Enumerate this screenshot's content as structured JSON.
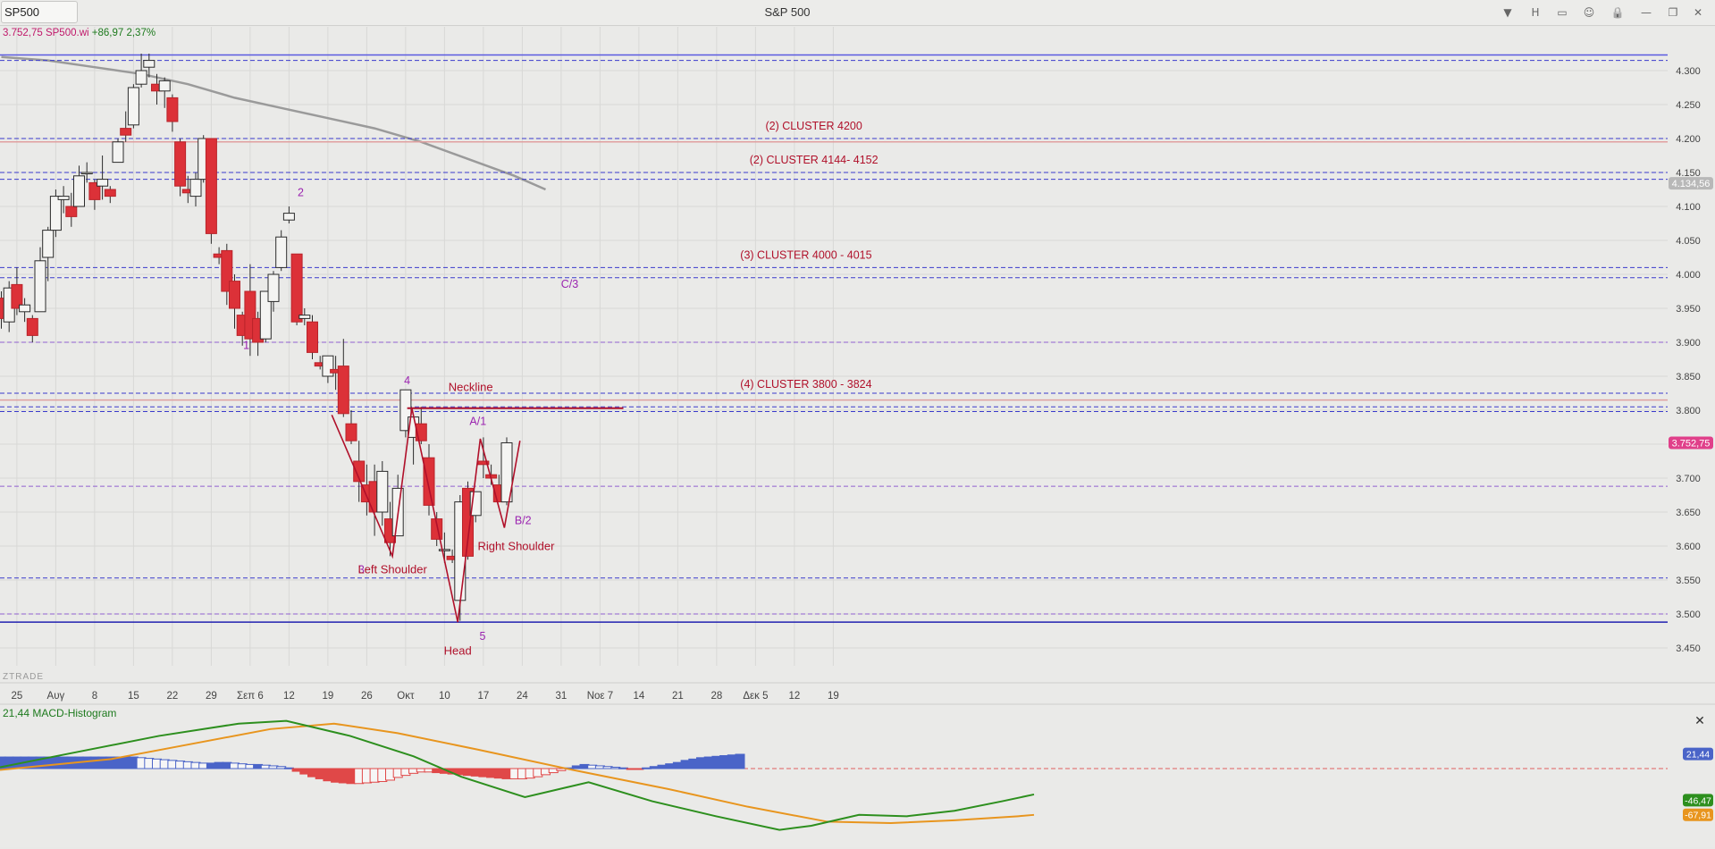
{
  "window": {
    "symbol": "SP500",
    "title": "S&P 500",
    "toolbar": [
      {
        "name": "dropdown-icon",
        "glyph": "▼"
      },
      {
        "name": "interval-button",
        "glyph": "H"
      },
      {
        "name": "layout-icon",
        "glyph": "▭"
      },
      {
        "name": "chat-icon",
        "glyph": "☺"
      },
      {
        "name": "lock-icon",
        "glyph": "🔒"
      },
      {
        "name": "minimize-icon",
        "glyph": "—"
      },
      {
        "name": "restore-icon",
        "glyph": "❐"
      },
      {
        "name": "close-icon",
        "glyph": "✕"
      }
    ]
  },
  "quote": {
    "price": "3.752,75",
    "symbol": "SP500.wi",
    "change": "+86,97",
    "change_pct": "2,37%"
  },
  "watermark": "ZTRADE",
  "colors": {
    "up": "#f4f4f2",
    "down": "#dc3138",
    "wick": "#2b2b2b",
    "annot": "#b0102a",
    "purple": "#9b24b0",
    "ma": "#9a9a9a",
    "grid": "#d8d8d6",
    "macd_line": "#2d8f1e",
    "signal_line": "#e8951e",
    "hist_pos": "#4a64c8",
    "hist_neg": "#e04848"
  },
  "chart_data": [
    {
      "type": "candlestick",
      "title": "S&P 500",
      "ylim": [
        3430,
        4340
      ],
      "y_ticks": [
        "4.300",
        "4.250",
        "4.200",
        "4.150",
        "4.100",
        "4.050",
        "4.000",
        "3.950",
        "3.900",
        "3.850",
        "3.800",
        "3.750",
        "3.700",
        "3.650",
        "3.600",
        "3.550",
        "3.500",
        "3.450"
      ],
      "y_tick_values": [
        4300,
        4250,
        4200,
        4150,
        4100,
        4050,
        4000,
        3950,
        3900,
        3850,
        3800,
        3750,
        3700,
        3650,
        3600,
        3550,
        3500,
        3450
      ],
      "x_tick_labels": [
        "25",
        "Αυγ",
        "8",
        "15",
        "22",
        "29",
        "Σεπ 6",
        "12",
        "19",
        "26",
        "Οκτ",
        "10",
        "17",
        "24",
        "31",
        "Νοε 7",
        "14",
        "21",
        "28",
        "Δεκ 5",
        "12",
        "19"
      ],
      "x_tick_slots": [
        2,
        7,
        12,
        17,
        22,
        27,
        32,
        37,
        42,
        47,
        52,
        57,
        62,
        67,
        72,
        77,
        82,
        87,
        92,
        97,
        102,
        107
      ],
      "candles": [
        [
          3965,
          3975,
          3920,
          3935
        ],
        [
          3930,
          3990,
          3915,
          3980
        ],
        [
          3985,
          4010,
          3940,
          3950
        ],
        [
          3945,
          3965,
          3930,
          3955
        ],
        [
          3935,
          3940,
          3900,
          3910
        ],
        [
          3945,
          4040,
          3945,
          4020
        ],
        [
          4025,
          4070,
          3990,
          4065
        ],
        [
          4065,
          4125,
          4055,
          4115
        ],
        [
          4110,
          4130,
          4090,
          4115
        ],
        [
          4100,
          4120,
          4070,
          4085
        ],
        [
          4100,
          4160,
          4100,
          4145
        ],
        [
          4150,
          4165,
          4135,
          4150
        ],
        [
          4135,
          4140,
          4095,
          4110
        ],
        [
          4130,
          4175,
          4110,
          4140
        ],
        [
          4125,
          4130,
          4105,
          4115
        ],
        [
          4165,
          4200,
          4165,
          4195
        ],
        [
          4215,
          4240,
          4195,
          4205
        ],
        [
          4220,
          4280,
          4215,
          4275
        ],
        [
          4280,
          4325,
          4275,
          4300
        ],
        [
          4305,
          4325,
          4290,
          4315
        ],
        [
          4280,
          4295,
          4250,
          4270
        ],
        [
          4270,
          4290,
          4245,
          4285
        ],
        [
          4260,
          4265,
          4210,
          4225
        ],
        [
          4195,
          4200,
          4115,
          4130
        ],
        [
          4125,
          4145,
          4105,
          4120
        ],
        [
          4115,
          4150,
          4100,
          4140
        ],
        [
          4140,
          4205,
          4135,
          4200
        ],
        [
          4200,
          4200,
          4045,
          4060
        ],
        [
          4030,
          4040,
          4015,
          4025
        ],
        [
          4035,
          4045,
          3955,
          3975
        ],
        [
          3990,
          4000,
          3920,
          3950
        ],
        [
          3940,
          3945,
          3895,
          3910
        ],
        [
          3975,
          4015,
          3880,
          3905
        ],
        [
          3935,
          3945,
          3880,
          3900
        ],
        [
          3905,
          3975,
          3900,
          3975
        ],
        [
          3960,
          4005,
          3945,
          4000
        ],
        [
          4010,
          4065,
          4005,
          4055
        ],
        [
          4080,
          4100,
          4075,
          4090
        ],
        [
          4030,
          4030,
          3925,
          3930
        ],
        [
          3935,
          3950,
          3925,
          3940
        ],
        [
          3930,
          3940,
          3875,
          3885
        ],
        [
          3870,
          3880,
          3860,
          3865
        ],
        [
          3850,
          3880,
          3840,
          3880
        ],
        [
          3860,
          3880,
          3830,
          3855
        ],
        [
          3865,
          3905,
          3790,
          3795
        ],
        [
          3780,
          3800,
          3750,
          3755
        ],
        [
          3725,
          3755,
          3665,
          3695
        ],
        [
          3690,
          3720,
          3645,
          3665
        ],
        [
          3695,
          3720,
          3615,
          3650
        ],
        [
          3650,
          3725,
          3630,
          3710
        ],
        [
          3640,
          3665,
          3585,
          3605
        ],
        [
          3615,
          3705,
          3615,
          3685
        ],
        [
          3770,
          3830,
          3760,
          3830
        ],
        [
          3760,
          3785,
          3720,
          3790
        ],
        [
          3780,
          3805,
          3750,
          3755
        ],
        [
          3730,
          3750,
          3645,
          3660
        ],
        [
          3640,
          3650,
          3600,
          3610
        ],
        [
          3595,
          3620,
          3575,
          3595
        ],
        [
          3585,
          3595,
          3575,
          3580
        ],
        [
          3520,
          3675,
          3490,
          3665
        ],
        [
          3685,
          3695,
          3580,
          3585
        ],
        [
          3645,
          3680,
          3635,
          3680
        ],
        [
          3725,
          3760,
          3700,
          3720
        ],
        [
          3705,
          3720,
          3690,
          3700
        ],
        [
          3690,
          3705,
          3665,
          3665
        ],
        [
          3665,
          3760,
          3660,
          3752
        ]
      ],
      "ma": [
        [
          0,
          4320
        ],
        [
          6,
          4315
        ],
        [
          12,
          4305
        ],
        [
          18,
          4295
        ],
        [
          24,
          4280
        ],
        [
          30,
          4260
        ],
        [
          36,
          4245
        ],
        [
          42,
          4230
        ],
        [
          48,
          4215
        ],
        [
          54,
          4195
        ],
        [
          60,
          4170
        ],
        [
          66,
          4145
        ],
        [
          70,
          4125
        ]
      ],
      "horizontal_lines": [
        {
          "v": 4323,
          "style": "solid",
          "color": "#5a5ae0"
        },
        {
          "v": 4315,
          "style": "dashed",
          "color": "#3a3acc"
        },
        {
          "v": 4200,
          "style": "dashed",
          "color": "#3a3acc"
        },
        {
          "v": 4195,
          "style": "solid",
          "color": "#e0a0a0"
        },
        {
          "v": 4150,
          "style": "dashed",
          "color": "#3a3acc"
        },
        {
          "v": 4140,
          "style": "dashed",
          "color": "#3a3acc"
        },
        {
          "v": 4010,
          "style": "dashed",
          "color": "#3a3acc"
        },
        {
          "v": 3995,
          "style": "dashed",
          "color": "#3a3acc"
        },
        {
          "v": 3900,
          "style": "dashed",
          "color": "#9060d0"
        },
        {
          "v": 3825,
          "style": "dashed",
          "color": "#3a3acc"
        },
        {
          "v": 3815,
          "style": "solid",
          "color": "#e0a0a0"
        },
        {
          "v": 3805,
          "style": "dashed",
          "color": "#3a3acc"
        },
        {
          "v": 3798,
          "style": "dashed",
          "color": "#3a3acc"
        },
        {
          "v": 3688,
          "style": "dashed",
          "color": "#9060d0"
        },
        {
          "v": 3553,
          "style": "dashed",
          "color": "#3a3acc"
        },
        {
          "v": 3500,
          "style": "dashed",
          "color": "#9060d0"
        },
        {
          "v": 3488,
          "style": "solid",
          "color": "#2020b0"
        }
      ],
      "cluster_labels": [
        {
          "text": "(2) CLUSTER 4200",
          "v": 4213,
          "slot": 104.5
        },
        {
          "text": "(2) CLUSTER 4144- 4152",
          "v": 4163,
          "slot": 104.5
        },
        {
          "text": "(3) CLUSTER 4000 - 4015",
          "v": 4023,
          "slot": 103.5
        },
        {
          "text": "(4)  CLUSTER 3800 - 3824",
          "v": 3833,
          "slot": 103.5
        }
      ],
      "neckline": {
        "label": "Neckline",
        "from_slot": 52.2,
        "to_slot": 80,
        "v": 3803,
        "label_slot": 57.5,
        "label_v": 3828
      },
      "pattern_path": [
        [
          42.5,
          3793
        ],
        [
          50.3,
          3585
        ],
        [
          52.8,
          3803
        ],
        [
          58.7,
          3488
        ],
        [
          61.6,
          3758
        ],
        [
          64.7,
          3627
        ],
        [
          66.7,
          3755
        ]
      ],
      "wave_labels": [
        {
          "text": "2",
          "slot": 38.5,
          "v": 4115
        },
        {
          "text": "1",
          "slot": 31.5,
          "v": 3890
        },
        {
          "text": "3",
          "slot": 46.3,
          "v": 3560
        },
        {
          "text": "4",
          "slot": 52.2,
          "v": 3838
        },
        {
          "text": "A/1",
          "slot": 61.3,
          "v": 3778
        },
        {
          "text": "C/3",
          "slot": 73.1,
          "v": 3980
        },
        {
          "text": "B/2",
          "slot": 67.1,
          "v": 3632
        },
        {
          "text": "5",
          "slot": 61.9,
          "v": 3462
        }
      ],
      "pattern_labels": [
        {
          "text": "Left Shoulder",
          "slot": 50.3,
          "v": 3560
        },
        {
          "text": "Head",
          "slot": 58.7,
          "v": 3440
        },
        {
          "text": "Right Shoulder",
          "slot": 66.2,
          "v": 3594
        }
      ],
      "price_tags": [
        {
          "text": "4.134,56",
          "v": 4134,
          "color": "#b8b8b8"
        },
        {
          "text": "3.752,75",
          "v": 3752,
          "color": "#e0408a"
        }
      ]
    },
    {
      "type": "bar+line",
      "title": "21,44 MACD-Histogram",
      "ylim": [
        -95,
        75
      ],
      "histogram": [
        17,
        17,
        17,
        17,
        17,
        17,
        17,
        17,
        17,
        17,
        17,
        17,
        17,
        17,
        17,
        17,
        17,
        17,
        16,
        15,
        14,
        13,
        12,
        11,
        10,
        9,
        8,
        8,
        9,
        9,
        8,
        7,
        6,
        6,
        5,
        4,
        3,
        1,
        -4,
        -8,
        -12,
        -15,
        -18,
        -20,
        -21,
        -22,
        -22,
        -21,
        -20,
        -19,
        -17,
        -13,
        -10,
        -7,
        -5,
        -5,
        -6,
        -7,
        -8,
        -9,
        -10,
        -11,
        -12,
        -13,
        -14,
        -15,
        -15,
        -15,
        -14,
        -12,
        -9,
        -6,
        -3,
        1,
        4,
        6,
        5,
        4,
        3,
        2,
        1,
        -1,
        -1,
        1,
        3,
        5,
        7,
        9,
        12,
        14,
        16,
        17,
        18,
        19,
        20,
        21
      ],
      "hist_slot_start": 0,
      "macd": [
        [
          0,
          2
        ],
        [
          10,
          25
        ],
        [
          20,
          48
        ],
        [
          30,
          66
        ],
        [
          36,
          70
        ],
        [
          44,
          48
        ],
        [
          52,
          18
        ],
        [
          58,
          -12
        ],
        [
          66,
          -42
        ],
        [
          74,
          -20
        ],
        [
          82,
          -48
        ],
        [
          90,
          -70
        ],
        [
          98,
          -90
        ],
        [
          102,
          -84
        ],
        [
          108,
          -68
        ],
        [
          114,
          -70
        ],
        [
          120,
          -62
        ],
        [
          126,
          -48
        ],
        [
          130,
          -38
        ]
      ],
      "signal": [
        [
          0,
          -2
        ],
        [
          14,
          14
        ],
        [
          24,
          36
        ],
        [
          34,
          58
        ],
        [
          42,
          66
        ],
        [
          50,
          52
        ],
        [
          60,
          28
        ],
        [
          72,
          -2
        ],
        [
          84,
          -30
        ],
        [
          94,
          -56
        ],
        [
          104,
          -78
        ],
        [
          112,
          -80
        ],
        [
          120,
          -76
        ],
        [
          128,
          -70
        ],
        [
          130,
          -68
        ]
      ],
      "tags": [
        {
          "text": "21,44",
          "v": 21.44,
          "color": "#4a64c8"
        },
        {
          "text": "-46,47",
          "v": -46.47,
          "color": "#2d8f1e"
        },
        {
          "text": "-67,91",
          "v": -67.91,
          "color": "#e8951e"
        }
      ]
    }
  ]
}
